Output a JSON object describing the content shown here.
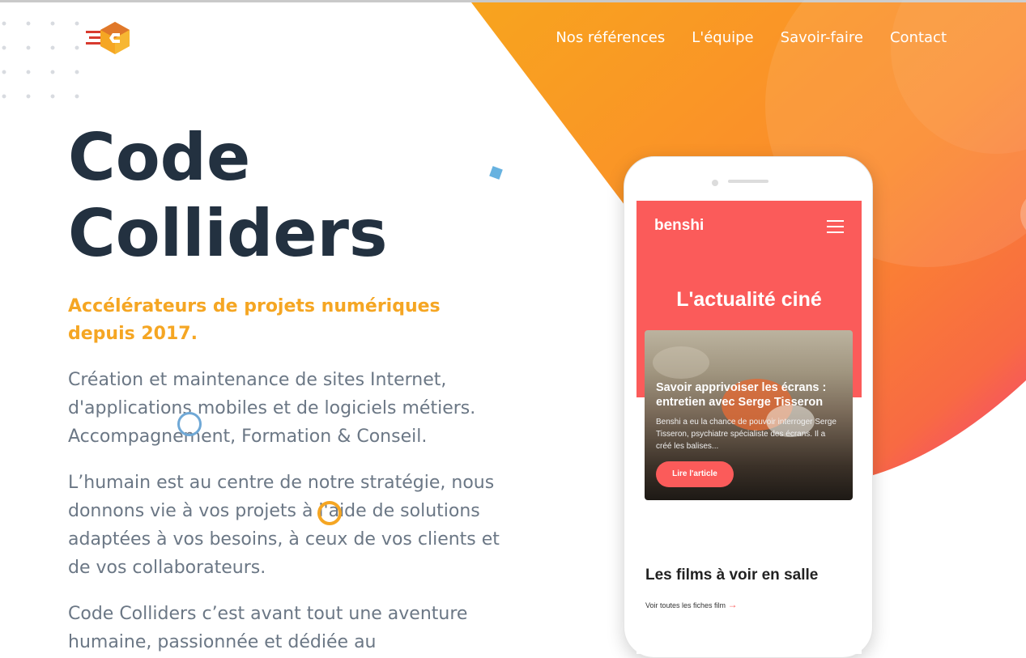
{
  "nav": {
    "items": [
      "Nos références",
      "L'équipe",
      "Savoir-faire",
      "Contact"
    ]
  },
  "hero": {
    "title_line1": "Code",
    "title_line2": "Colliders",
    "tagline": "Accélérateurs de projets numériques depuis 2017.",
    "paragraph1": "Création et maintenance de sites Internet, d'applications mobiles et de logiciels métiers. Accompagnement, Formation & Conseil.",
    "paragraph2": "L’humain est au centre de notre stratégie, nous donnons vie à vos projets à l'aide de solutions adaptées à vos besoins, à ceux de vos clients et de vos collaborateurs.",
    "paragraph3": "Code Colliders c’est avant tout une aventure humaine, passionnée et dédiée au"
  },
  "phone": {
    "brand": "benshi",
    "headline": "L'actualité ciné",
    "card_title": "Savoir apprivoiser les écrans : entretien avec Serge Tisseron",
    "card_desc": "Benshi a eu la chance de pouvoir interroger Serge Tisseron, psychiatre spécialiste des écrans. Il a créé les balises...",
    "card_button": "Lire l'article",
    "section_title": "Les films à voir en salle",
    "section_link": "Voir toutes les fiches film",
    "section_link_arrow": "→"
  },
  "colors": {
    "title": "#233140",
    "accent": "#f5a623",
    "body_text": "#6b7785",
    "phone_brand": "#fb5b5a"
  },
  "icons": [
    "code-colliders-logo",
    "hamburger-menu-icon",
    "arrow-right-icon"
  ]
}
